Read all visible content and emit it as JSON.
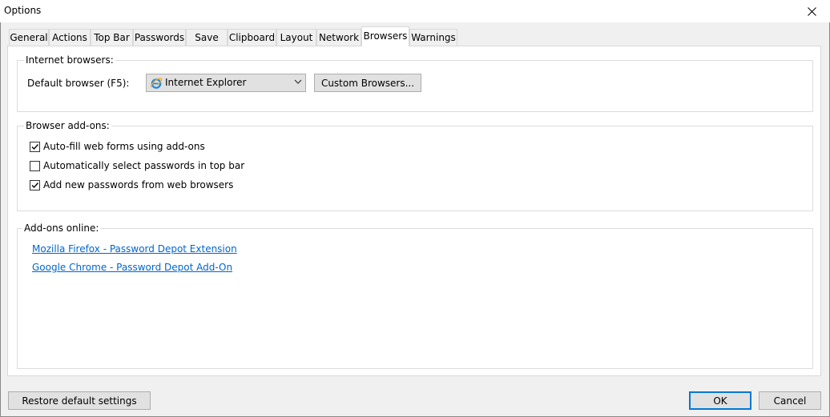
{
  "window": {
    "title": "Options"
  },
  "tabs": [
    {
      "label": "General",
      "active": false
    },
    {
      "label": "Actions",
      "active": false
    },
    {
      "label": "Top Bar",
      "active": false
    },
    {
      "label": "Passwords",
      "active": false
    },
    {
      "label": "Save",
      "active": false
    },
    {
      "label": "Clipboard",
      "active": false
    },
    {
      "label": "Layout",
      "active": false
    },
    {
      "label": "Network",
      "active": false
    },
    {
      "label": "Browsers",
      "active": true
    },
    {
      "label": "Warnings",
      "active": false
    }
  ],
  "internet_browsers": {
    "legend": "Internet browsers:",
    "default_browser_label": "Default browser (F5):",
    "default_browser_value": "Internet Explorer",
    "default_browser_icon": "internet-explorer-icon",
    "custom_browsers_button": "Custom Browsers..."
  },
  "browser_addons": {
    "legend": "Browser add-ons:",
    "options": [
      {
        "label": "Auto-fill web forms using add-ons",
        "checked": true
      },
      {
        "label": "Automatically select passwords in top bar",
        "checked": false
      },
      {
        "label": "Add new passwords from web browsers",
        "checked": true
      }
    ]
  },
  "addons_online": {
    "legend": "Add-ons online:",
    "links": [
      {
        "label": "Mozilla Firefox - Password Depot Extension"
      },
      {
        "label": "Google Chrome - Password Depot Add-On"
      }
    ]
  },
  "footer": {
    "restore_button": "Restore default settings",
    "ok_button": "OK",
    "cancel_button": "Cancel"
  },
  "colors": {
    "link": "#0066cc",
    "accent": "#0078d7",
    "panel": "#ffffff",
    "dialog": "#f0f0f0"
  }
}
